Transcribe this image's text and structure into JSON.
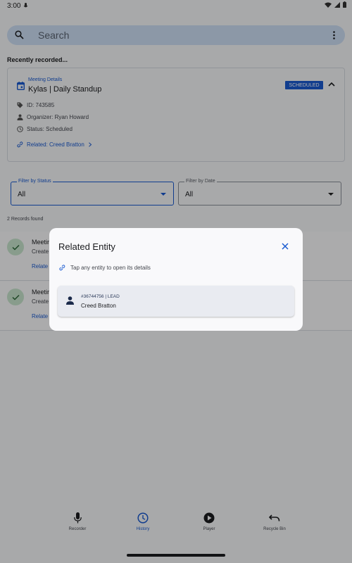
{
  "status_bar": {
    "time": "3:00"
  },
  "search": {
    "placeholder": "Search"
  },
  "section_title": "Recently recorded...",
  "meeting_card": {
    "overline": "Meeting Details",
    "title": "Kylas | Daily Standup",
    "badge": "SCHEDULED",
    "id_text": "ID: 743585",
    "organizer_text": "Organizer: Ryan Howard",
    "status_text": "Status: Scheduled",
    "related_text": "Related: Creed Bratton"
  },
  "filters": {
    "status": {
      "label": "Filter by Status",
      "value": "All"
    },
    "date": {
      "label": "Filter by Date",
      "value": "All"
    }
  },
  "records_count": "2 Records found",
  "records": [
    {
      "title": "Meetin",
      "subtitle": "Create",
      "link": "Relate"
    },
    {
      "title": "Meetin",
      "subtitle": "Create",
      "link": "Relate"
    }
  ],
  "bottom_nav": [
    {
      "label": "Recorder",
      "icon": "mic-icon",
      "active": false
    },
    {
      "label": "History",
      "icon": "clock-icon",
      "active": true
    },
    {
      "label": "Player",
      "icon": "play-circle-icon",
      "active": false
    },
    {
      "label": "Recycle Bin",
      "icon": "undo-icon",
      "active": false
    }
  ],
  "dialog": {
    "title": "Related Entity",
    "hint": "Tap any entity to open its details",
    "entity": {
      "meta": "#36744756 | LEAD",
      "name": "Creed Bratton"
    }
  },
  "colors": {
    "accent": "#1a5bd1",
    "search_bg": "#cfe0f6",
    "check_bg": "#c9e6cf"
  }
}
